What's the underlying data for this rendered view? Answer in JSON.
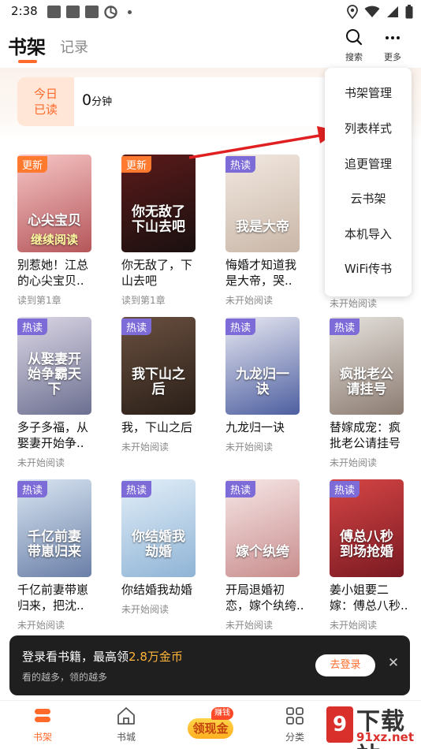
{
  "status_bar": {
    "time": "2:38"
  },
  "header": {
    "tab_active": "书架",
    "tab_inactive": "记录",
    "search_label": "搜索",
    "more_label": "更多"
  },
  "stats": {
    "today_line1": "今日",
    "today_line2": "已读",
    "minutes_value": "0",
    "minutes_unit": "分钟"
  },
  "menu": {
    "items": [
      "书架管理",
      "列表样式",
      "追更管理",
      "云书架",
      "本机导入",
      "WiFi传书"
    ]
  },
  "books": [
    {
      "title": "别惹她！江总的心尖宝贝..",
      "status": "读到第1章",
      "tag": "更新",
      "cover_text": "心尖宝贝",
      "cover_action": "继续阅读",
      "colors": [
        "#f7c6c6",
        "#b5565a"
      ]
    },
    {
      "title": "你无敌了，下山去吧",
      "status": "读到第1章",
      "tag": "更新",
      "cover_text": "你无敌了下山去吧",
      "colors": [
        "#5c1a1a",
        "#1a1010"
      ]
    },
    {
      "title": "悔婚才知道我是大帝，哭..",
      "status": "未开始阅读",
      "tag": "热读",
      "cover_text": "我是大帝",
      "colors": [
        "#f2e8e0",
        "#c9b7a8"
      ]
    },
    {
      "title": "",
      "status": "未开始阅读",
      "tag": "",
      "cover_text": "",
      "colors": [
        "#ffffff",
        "#ffffff"
      ]
    },
    {
      "title": "多子多福，从娶妻开始争..",
      "status": "未开始阅读",
      "tag": "热读",
      "cover_text": "从娶妻开始争霸天下",
      "colors": [
        "#dcd7e6",
        "#6b6f90"
      ]
    },
    {
      "title": "我，下山之后",
      "status": "未开始阅读",
      "tag": "热读",
      "cover_text": "我下山之后",
      "colors": [
        "#6a5040",
        "#2a1f18"
      ]
    },
    {
      "title": "九龙归一诀",
      "status": "未开始阅读",
      "tag": "热读",
      "cover_text": "九龙归一诀",
      "colors": [
        "#e8e8f2",
        "#4d5fa0"
      ]
    },
    {
      "title": "替嫁成宠：疯批老公请挂号",
      "status": "未开始阅读",
      "tag": "热读",
      "cover_text": "疯批老公请挂号",
      "colors": [
        "#e6e2dd",
        "#8c7c72"
      ]
    },
    {
      "title": "千亿前妻带崽归来，把沈..",
      "status": "未开始阅读",
      "tag": "热读",
      "cover_text": "千亿前妻带崽归来",
      "colors": [
        "#d9e6f2",
        "#6a7fa8"
      ]
    },
    {
      "title": "你结婚我劫婚",
      "status": "未开始阅读",
      "tag": "热读",
      "cover_text": "你结婚我劫婚",
      "colors": [
        "#e2eef8",
        "#8fb4d6"
      ]
    },
    {
      "title": "开局退婚初恋，嫁个纨绔..",
      "status": "未开始阅读",
      "tag": "热读",
      "cover_text": "嫁个纨绔",
      "colors": [
        "#f6e6e6",
        "#c98d8d"
      ]
    },
    {
      "title": "姜小姐要二嫁：傅总八秒..",
      "status": "未开始阅读",
      "tag": "热读",
      "cover_text": "傅总八秒到场抢婚",
      "colors": [
        "#d64545",
        "#7a1a22"
      ]
    }
  ],
  "login_banner": {
    "main_prefix": "登录看书籍，最高领",
    "highlight": "2.8万金币",
    "sub": "看的越多，领的越多",
    "button": "去登录"
  },
  "bottom_nav": {
    "shelf": "书架",
    "store": "书城",
    "cash": "领现金",
    "cash_badge": "赚钱",
    "category": "分类"
  },
  "watermark": {
    "big": "9",
    "text": "下载站",
    "url": "91xz.net"
  }
}
